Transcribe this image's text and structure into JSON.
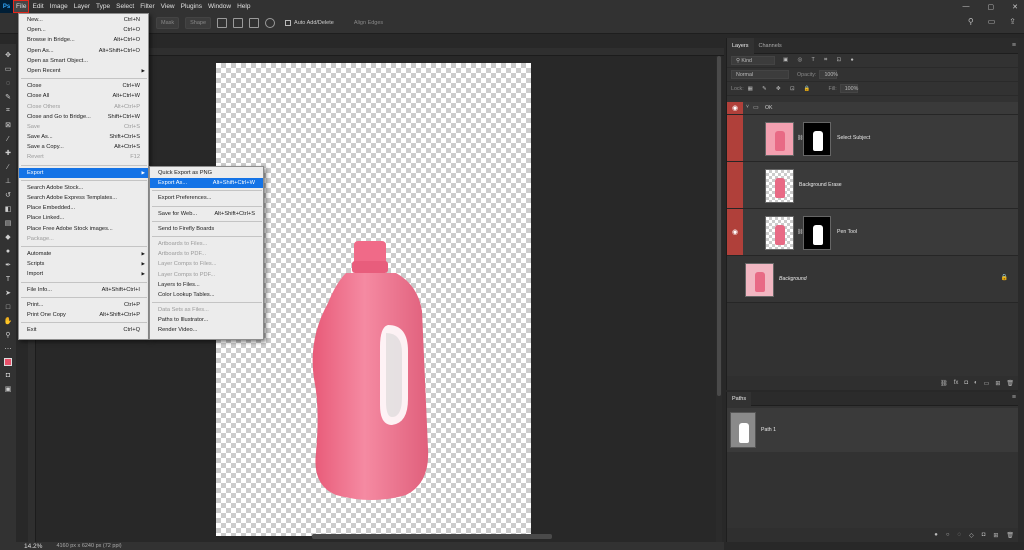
{
  "app": {
    "logo": "Ps"
  },
  "menubar": [
    "File",
    "Edit",
    "Image",
    "Layer",
    "Type",
    "Select",
    "Filter",
    "View",
    "Plugins",
    "Window",
    "Help"
  ],
  "window_controls": [
    "—",
    "▢",
    "✕"
  ],
  "options": {
    "mask": "Mask",
    "shape": "Shape",
    "auto_add_delete": "Auto Add/Delete",
    "align_edges": "Align Edges"
  },
  "file_menu": {
    "items": [
      {
        "label": "New...",
        "shortcut": "Ctrl+N",
        "disabled": false
      },
      {
        "label": "Open...",
        "shortcut": "Ctrl+O",
        "disabled": false
      },
      {
        "label": "Browse in Bridge...",
        "shortcut": "Alt+Ctrl+O",
        "disabled": false
      },
      {
        "label": "Open As...",
        "shortcut": "Alt+Shift+Ctrl+O",
        "disabled": false
      },
      {
        "label": "Open as Smart Object...",
        "shortcut": "",
        "disabled": false
      },
      {
        "label": "Open Recent",
        "shortcut": "",
        "disabled": false,
        "submenu": true
      },
      {
        "sep": true
      },
      {
        "label": "Close",
        "shortcut": "Ctrl+W",
        "disabled": false
      },
      {
        "label": "Close All",
        "shortcut": "Alt+Ctrl+W",
        "disabled": false
      },
      {
        "label": "Close Others",
        "shortcut": "Alt+Ctrl+P",
        "disabled": true
      },
      {
        "label": "Close and Go to Bridge...",
        "shortcut": "Shift+Ctrl+W",
        "disabled": false
      },
      {
        "label": "Save",
        "shortcut": "Ctrl+S",
        "disabled": true
      },
      {
        "label": "Save As...",
        "shortcut": "Shift+Ctrl+S",
        "disabled": false
      },
      {
        "label": "Save a Copy...",
        "shortcut": "Alt+Ctrl+S",
        "disabled": false
      },
      {
        "label": "Revert",
        "shortcut": "F12",
        "disabled": true
      },
      {
        "sep": true
      },
      {
        "label": "Export",
        "shortcut": "",
        "disabled": false,
        "submenu": true,
        "highlight": true
      },
      {
        "sep": true
      },
      {
        "label": "Search Adobe Stock...",
        "shortcut": "",
        "disabled": false
      },
      {
        "label": "Search Adobe Express Templates...",
        "shortcut": "",
        "disabled": false
      },
      {
        "label": "Place Embedded...",
        "shortcut": "",
        "disabled": false
      },
      {
        "label": "Place Linked...",
        "shortcut": "",
        "disabled": false
      },
      {
        "label": "Place Free Adobe Stock images...",
        "shortcut": "",
        "disabled": false
      },
      {
        "label": "Package...",
        "shortcut": "",
        "disabled": true
      },
      {
        "sep": true
      },
      {
        "label": "Automate",
        "shortcut": "",
        "disabled": false,
        "submenu": true
      },
      {
        "label": "Scripts",
        "shortcut": "",
        "disabled": false,
        "submenu": true
      },
      {
        "label": "Import",
        "shortcut": "",
        "disabled": false,
        "submenu": true
      },
      {
        "sep": true
      },
      {
        "label": "File Info...",
        "shortcut": "Alt+Shift+Ctrl+I",
        "disabled": false
      },
      {
        "sep": true
      },
      {
        "label": "Print...",
        "shortcut": "Ctrl+P",
        "disabled": false
      },
      {
        "label": "Print One Copy",
        "shortcut": "Alt+Shift+Ctrl+P",
        "disabled": false
      },
      {
        "sep": true
      },
      {
        "label": "Exit",
        "shortcut": "Ctrl+Q",
        "disabled": false
      }
    ]
  },
  "export_menu": {
    "items": [
      {
        "label": "Quick Export as PNG",
        "shortcut": "",
        "disabled": false
      },
      {
        "label": "Export As...",
        "shortcut": "Alt+Shift+Ctrl+W",
        "disabled": false,
        "highlight": true
      },
      {
        "sep": true
      },
      {
        "label": "Export Preferences...",
        "shortcut": "",
        "disabled": false
      },
      {
        "sep": true
      },
      {
        "label": "Save for Web...",
        "shortcut": "Alt+Shift+Ctrl+S",
        "disabled": false
      },
      {
        "sep": true
      },
      {
        "label": "Send to Firefly Boards",
        "shortcut": "",
        "disabled": false
      },
      {
        "sep": true
      },
      {
        "label": "Artboards to Files...",
        "shortcut": "",
        "disabled": true
      },
      {
        "label": "Artboards to PDF...",
        "shortcut": "",
        "disabled": true
      },
      {
        "label": "Layer Comps to Files...",
        "shortcut": "",
        "disabled": true
      },
      {
        "label": "Layer Comps to PDF...",
        "shortcut": "",
        "disabled": true
      },
      {
        "label": "Layers to Files...",
        "shortcut": "",
        "disabled": false
      },
      {
        "label": "Color Lookup Tables...",
        "shortcut": "",
        "disabled": false
      },
      {
        "sep": true
      },
      {
        "label": "Data Sets as Files...",
        "shortcut": "",
        "disabled": true
      },
      {
        "label": "Paths to Illustrator...",
        "shortcut": "",
        "disabled": false
      },
      {
        "label": "Render Video...",
        "shortcut": "",
        "disabled": false
      }
    ]
  },
  "layers_panel": {
    "tabs": [
      "Layers",
      "Channels"
    ],
    "kind": "Kind",
    "blend_mode": "Normal",
    "opacity_label": "Opacity:",
    "opacity_value": "100%",
    "lock_label": "Lock:",
    "fill_label": "Fill:",
    "fill_value": "100%",
    "group_name": "OK",
    "layers": [
      "Select Subject",
      "Background Erase",
      "Pen Tool",
      "Background"
    ]
  },
  "paths_panel": {
    "tab": "Paths",
    "path_name": "Path 1"
  },
  "status": {
    "zoom": "14.2%",
    "doc_info": "4160 px x 6240 px (72 ppi)"
  },
  "colors": {
    "accent": "#1473e6",
    "layer_highlight": "#b0403a",
    "bottle": "#f07890"
  }
}
